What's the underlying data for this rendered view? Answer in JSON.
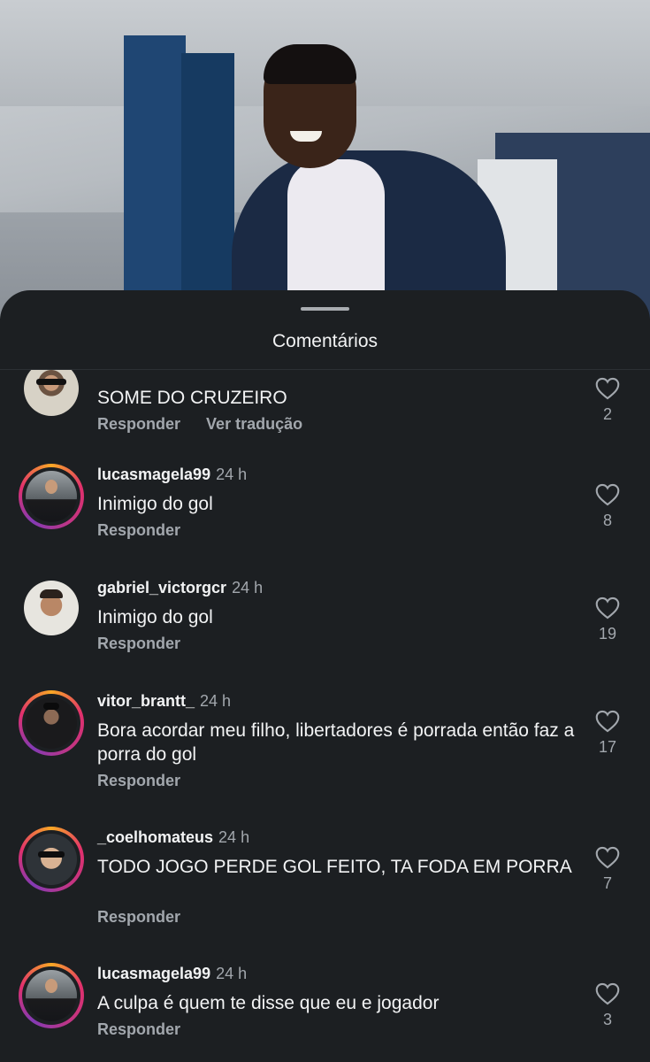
{
  "sheet": {
    "title": "Comentários"
  },
  "comments": [
    {
      "username": "",
      "time": "",
      "text": "SOME DO CRUZEIRO",
      "reply_label": "Responder",
      "translate_label": "Ver tradução",
      "likes": "2",
      "story_ring": false
    },
    {
      "username": "lucasmagela99",
      "time": "24 h",
      "text": "Inimigo do gol",
      "reply_label": "Responder",
      "likes": "8",
      "story_ring": true
    },
    {
      "username": "gabriel_victorgcr",
      "time": "24 h",
      "text": "Inimigo do gol",
      "reply_label": "Responder",
      "likes": "19",
      "story_ring": false
    },
    {
      "username": "vitor_brantt_",
      "time": "24 h",
      "text": "Bora acordar meu filho, libertadores é porrada então faz a porra do gol",
      "reply_label": "Responder",
      "likes": "17",
      "story_ring": true
    },
    {
      "username": "_coelhomateus",
      "time": "24 h",
      "text": "TODO JOGO PERDE GOL FEITO, TA FODA EM PORRA",
      "reply_label": "Responder",
      "likes": "7",
      "story_ring": true
    },
    {
      "username": "lucasmagela99",
      "time": "24 h",
      "text": "A culpa é quem te disse que eu e jogador",
      "reply_label": "Responder",
      "likes": "3",
      "story_ring": true
    }
  ],
  "colors": {
    "background": "#1c1f22",
    "secondary_text": "#a2a7ad",
    "primary_text": "#f2f3f4"
  },
  "icons": {
    "like": "heart-outline-icon"
  }
}
